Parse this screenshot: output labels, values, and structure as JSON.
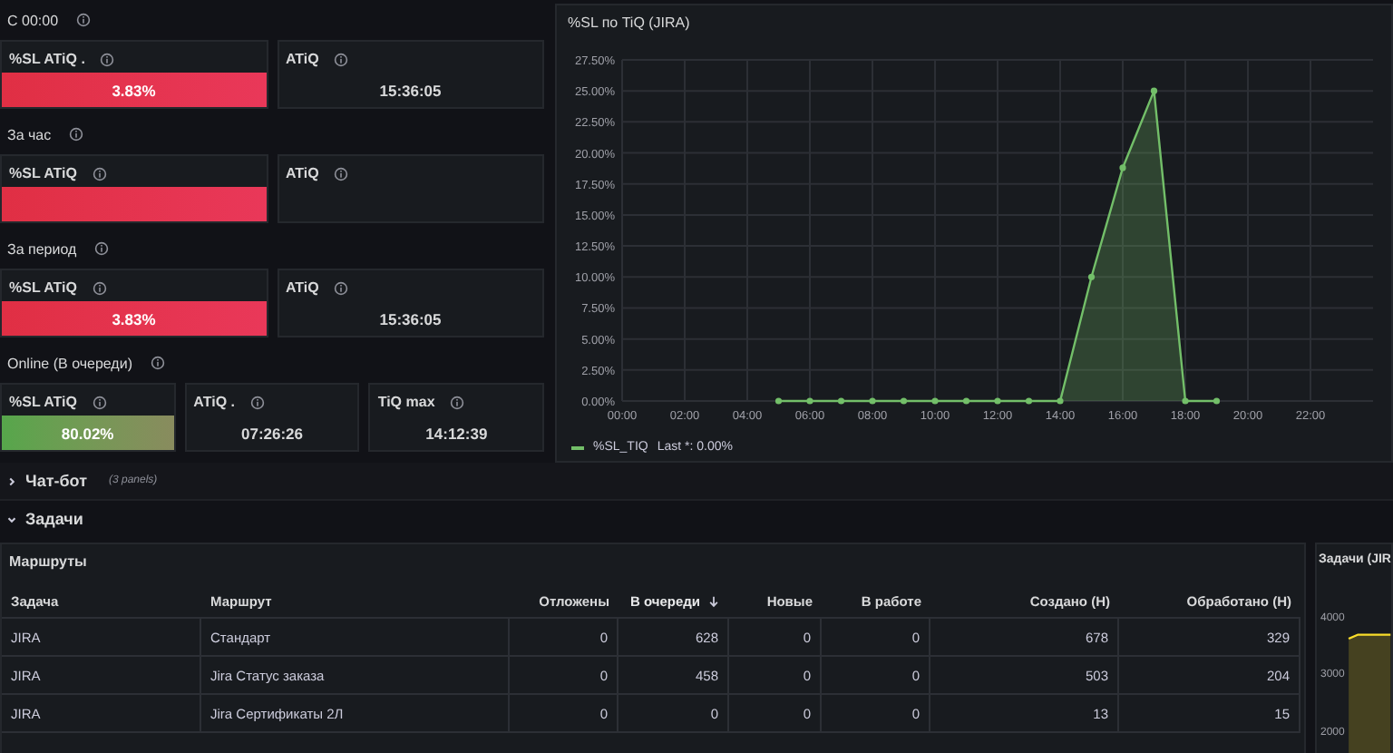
{
  "stat_groups": [
    {
      "title": "С 00:00",
      "panels": [
        {
          "kind": "bar",
          "title": "%SL ATiQ .",
          "value": "3.83%",
          "color": "#e02f44"
        },
        {
          "kind": "plain",
          "title": "ATiQ",
          "value": "15:36:05"
        }
      ]
    },
    {
      "title": "За час",
      "panels": [
        {
          "kind": "bar",
          "title": "%SL ATiQ",
          "color": "#e02f44"
        },
        {
          "kind": "plain",
          "title": "ATiQ"
        }
      ]
    },
    {
      "title": "За период",
      "panels": [
        {
          "kind": "bar",
          "title": "%SL ATiQ",
          "value": "3.83%",
          "color": "#e02f44"
        },
        {
          "kind": "plain",
          "title": "ATiQ",
          "value": "15:36:05"
        }
      ]
    },
    {
      "title": "Online (В очереди)",
      "panels": [
        {
          "kind": "bar",
          "title": "%SL ATiQ",
          "value": "80.02%",
          "color": "#56a64b"
        },
        {
          "kind": "plain",
          "title": "ATiQ .",
          "value": "07:26:26"
        },
        {
          "kind": "plain",
          "title": "TiQ max",
          "value": "14:12:39"
        }
      ]
    }
  ],
  "chart_panel": {
    "title": "%SL по TiQ (JIRA)",
    "legend": {
      "text": "Last *: 0.00%"
    },
    "chart_data": {
      "type": "area",
      "x": [
        5,
        6,
        7,
        8,
        9,
        10,
        11,
        12,
        13,
        14,
        15,
        16,
        17,
        18,
        19
      ],
      "series": [
        {
          "name": "%SL_TIQ",
          "color": "#73bf69",
          "values": [
            0,
            0,
            0,
            0,
            0,
            0,
            0,
            0,
            0,
            0,
            10,
            18.8,
            25,
            0,
            0
          ]
        }
      ],
      "grid": true,
      "xlim": [
        0,
        24
      ],
      "ylim": [
        0,
        27.5
      ],
      "xticks": [
        {
          "value": 0,
          "label": "00:00"
        },
        {
          "value": 2,
          "label": "02:00"
        },
        {
          "value": 4,
          "label": "04:00"
        },
        {
          "value": 6,
          "label": "06:00"
        },
        {
          "value": 8,
          "label": "08:00"
        },
        {
          "value": 10,
          "label": "10:00"
        },
        {
          "value": 12,
          "label": "12:00"
        },
        {
          "value": 14,
          "label": "14:00"
        },
        {
          "value": 16,
          "label": "16:00"
        },
        {
          "value": 18,
          "label": "18:00"
        },
        {
          "value": 20,
          "label": "20:00"
        },
        {
          "value": 22,
          "label": "22:00"
        }
      ],
      "yticks": [
        {
          "value": 0,
          "label": "0.00%"
        },
        {
          "value": 2.5,
          "label": "2.50%"
        },
        {
          "value": 5,
          "label": "5.00%"
        },
        {
          "value": 7.5,
          "label": "7.50%"
        },
        {
          "value": 10,
          "label": "10.00%"
        },
        {
          "value": 12.5,
          "label": "12.50%"
        },
        {
          "value": 15,
          "label": "15.00%"
        },
        {
          "value": 17.5,
          "label": "17.50%"
        },
        {
          "value": 20,
          "label": "20.00%"
        },
        {
          "value": 22.5,
          "label": "22.50%"
        },
        {
          "value": 25,
          "label": "25.00%"
        },
        {
          "value": 27.5,
          "label": "27.50%"
        }
      ]
    }
  },
  "rows": [
    {
      "title": "Чат-бот",
      "expanded": false,
      "note": "(3 panels)"
    },
    {
      "title": "Задачи",
      "expanded": true
    }
  ],
  "table_panel": {
    "title": "Маршруты",
    "columns": [
      {
        "label": "Задача",
        "sorted": false
      },
      {
        "label": "Маршрут",
        "sorted": false
      },
      {
        "label": "Отложены",
        "sorted": false
      },
      {
        "label": "В очереди",
        "sorted": true
      },
      {
        "label": "Новые",
        "sorted": false
      },
      {
        "label": "В работе",
        "sorted": false
      },
      {
        "label": "Создано (Н)",
        "sorted": false
      },
      {
        "label": "Обработано (Н)",
        "sorted": false
      }
    ],
    "rows": [
      [
        "JIRA",
        "Стандарт",
        "0",
        "628",
        "0",
        "0",
        "678",
        "329"
      ],
      [
        "JIRA",
        "Jira Статус заказа",
        "0",
        "458",
        "0",
        "0",
        "503",
        "204"
      ],
      [
        "JIRA",
        "Jira Сертификаты 2Л",
        "0",
        "0",
        "0",
        "0",
        "13",
        "15"
      ]
    ]
  },
  "side_panel": {
    "title": "Задачи (JIR",
    "axis_labels": [
      "4000",
      "3000",
      "2000"
    ]
  }
}
